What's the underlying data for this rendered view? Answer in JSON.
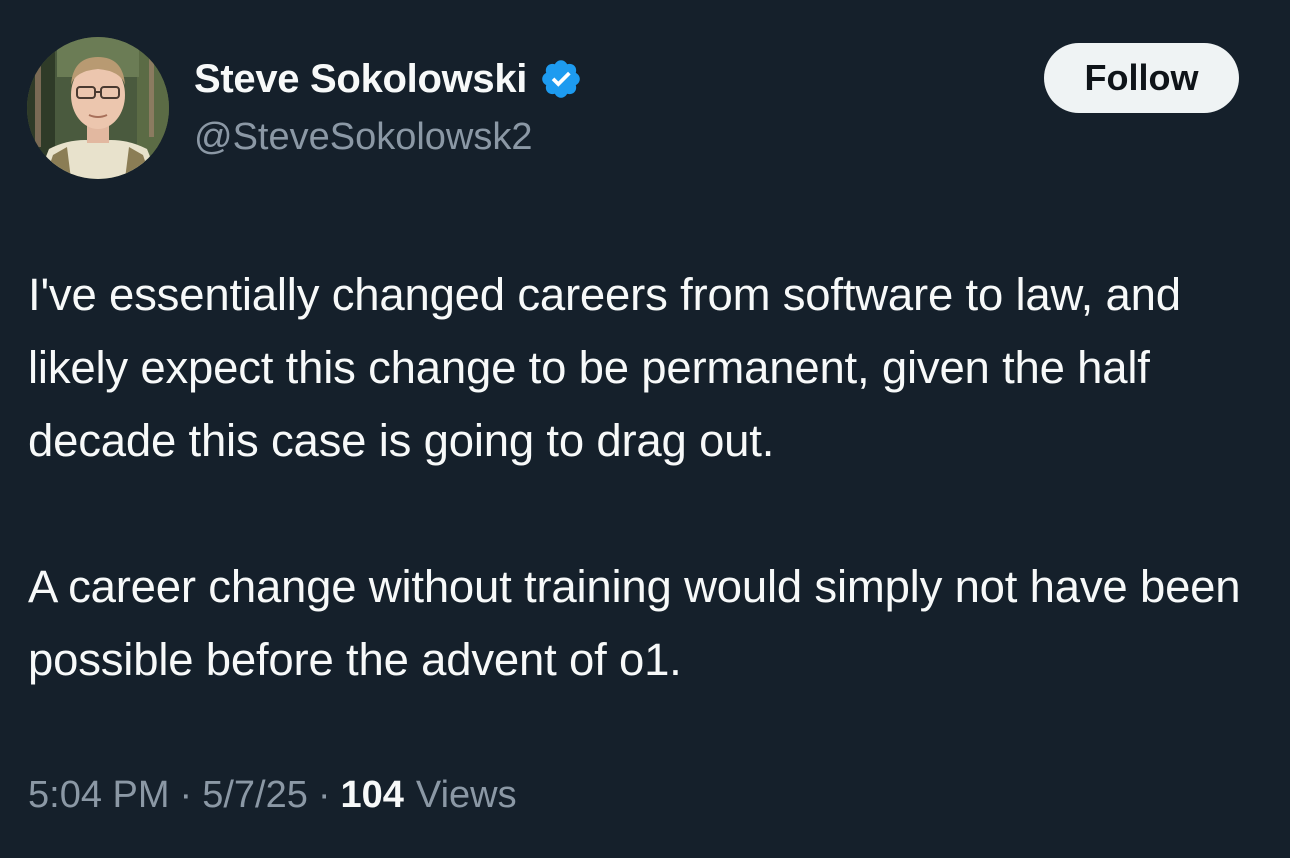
{
  "tweet": {
    "author": {
      "display_name": "Steve Sokolowski",
      "handle": "@SteveSokolowsk2",
      "verified": true,
      "avatar": "profile-photo"
    },
    "follow_label": "Follow",
    "paragraphs": [
      "I've essentially changed careers from software to law, and likely expect this change to be permanent, given the half decade this case is going to drag out.",
      "A career change without training would simply not have been possible before the advent of o1."
    ],
    "meta": {
      "time": "5:04 PM",
      "separator": "·",
      "date": "5/7/25",
      "views_count": "104",
      "views_label": "Views"
    }
  },
  "colors": {
    "background": "#15202b",
    "text_primary": "#f7f9f9",
    "text_secondary": "#8b98a5",
    "verified_badge": "#1d9bf0",
    "follow_button_bg": "#eff3f4",
    "follow_button_text": "#0f1419"
  }
}
